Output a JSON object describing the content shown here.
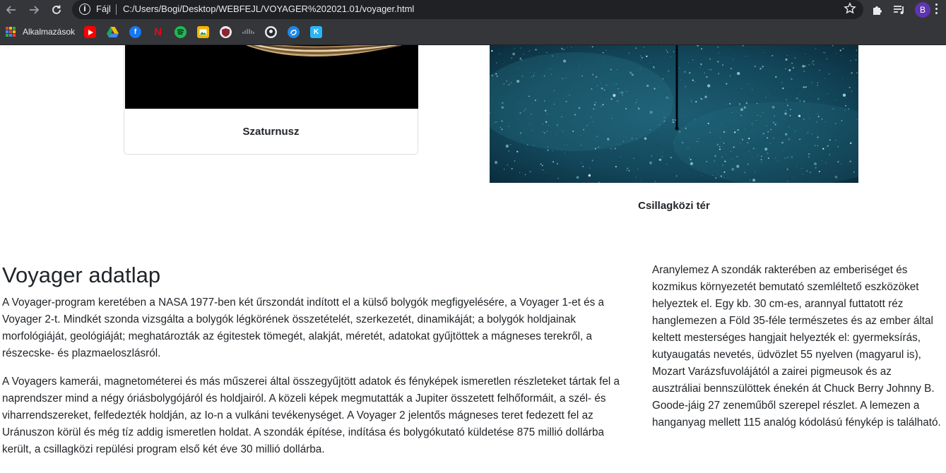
{
  "browser": {
    "scheme_label": "Fájl",
    "url": "C:/Users/Bogi/Desktop/WEBFEJL/VOYAGER%202021.01/voyager.html",
    "profile_initial": "B",
    "icons": {
      "back": "back-arrow-icon",
      "forward": "forward-arrow-icon",
      "reload": "reload-icon",
      "info": "info-icon",
      "bookmark_star": "star-icon",
      "extensions": "puzzle-icon",
      "media": "playlist-icon",
      "menu": "kebab-menu-icon"
    }
  },
  "bookmarks": {
    "apps_label": "Alkalmazások",
    "items": [
      {
        "icon": "youtube-icon",
        "color": "#ff0000"
      },
      {
        "icon": "google-drive-icon",
        "color": "#1fa463"
      },
      {
        "icon": "facebook-icon",
        "color": "#1877f2"
      },
      {
        "icon": "netflix-icon",
        "color": "#e50914"
      },
      {
        "icon": "spotify-icon",
        "color": "#1db954"
      },
      {
        "icon": "photo-icon",
        "color": "#f4b400"
      },
      {
        "icon": "shield-icon",
        "color": "#8e2430"
      },
      {
        "icon": "cisco-icon",
        "color": "#5f6368"
      },
      {
        "icon": "github-icon",
        "color": "#ffffff"
      },
      {
        "icon": "swirl-icon",
        "color": "#1e88e5"
      },
      {
        "icon": "k-icon",
        "color": "#29b6f6"
      }
    ]
  },
  "gallery": {
    "card_title": "Szaturnusz",
    "space_caption": "Csillagközi tér"
  },
  "main": {
    "title": "Voyager adatlap",
    "paragraph_1": "A Voyager-program keretében a NASA 1977-ben két űrszondát indított el a külső bolygók megfigyelésére, a Voyager 1-et és a Voyager 2-t. Mindkét szonda vizsgálta a bolygók légkörének összetételét, szerkezetét, dinamikáját; a bolygók holdjainak morfológiáját, geológiáját; meghatározták az égitestek tömegét, alakját, méretét, adatokat gyűjtöttek a mágneses terekről, a részecske- és plazmaeloszlásról.",
    "paragraph_2": "A Voyagers kamerái, magnetométerei és más műszerei által összegyűjtött adatok és fényképek ismeretlen részleteket tártak fel a naprendszer mind a négy óriásbolygójáról és holdjairól. A közeli képek megmutatták a Jupiter összetett felhőformáit, a szél- és viharrendszereket, felfedezték holdján, az Io-n a vulkáni tevékenységet. A Voyager 2 jelentős mágneses teret fedezett fel az Uránuszon körül és még tíz addig ismeretlen holdat. A szondák építése, indítása és bolygókutató küldetése 875 millió dollárba került, a csillagközi repülési program első két éve 30 millió dollárba.",
    "side_paragraph": "Aranylemez A szondák rakterében az emberiséget és kozmikus környezetét bemutató szemléltető eszközöket helyeztek el. Egy kb. 30 cm-es, arannyal futtatott réz hanglemezen a Föld 35-féle természetes és az ember által keltett mesterséges hangjait helyezték el: gyermeksírás, kutyaugatás nevetés, üdvözlet 55 nyelven (magyarul is), Mozart Varázsfuvolájától a zairei pigmeusok és az ausztráliai bennszülöttek énekén át Chuck Berry Johnny B. Goode-jáig 27 zeneműből szerepel részlet. A lemezen a hanganyag mellett 115 analóg kódolású fénykép is található."
  }
}
